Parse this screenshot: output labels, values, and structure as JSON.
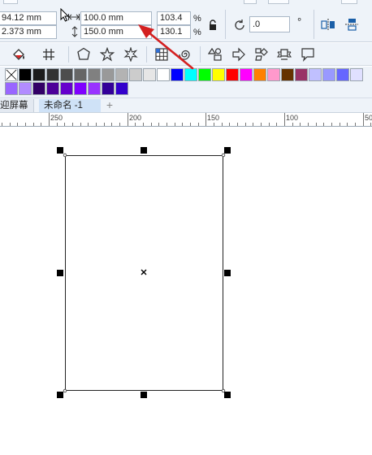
{
  "property_bar": {
    "x_value": "94.12 mm",
    "y_value": "2.373 mm",
    "width_value": "100.0 mm",
    "height_value": "150.0 mm",
    "scale_x": "103.4",
    "scale_y": "130.1",
    "percent_symbol": "%",
    "rotation_value": ".0",
    "degree_symbol": "°"
  },
  "palette": {
    "row1": [
      "#000000",
      "#1c1c1c",
      "#333333",
      "#4d4d4d",
      "#666666",
      "#808080",
      "#999999",
      "#b3b3b3",
      "#cccccc",
      "#e6e6e6",
      "#ffffff",
      "#0000ff",
      "#00ffff",
      "#00ff00",
      "#ffff00",
      "#ff0000",
      "#ff00ff",
      "#ff8000",
      "#ff99cc",
      "#663300",
      "#993366",
      "#c0c0ff",
      "#9999ff",
      "#6666ff",
      "#e0e0ff"
    ],
    "row2": [
      "#9966ff",
      "#b28cff",
      "#330066",
      "#4d0099",
      "#6600cc",
      "#8000ff",
      "#9933ff",
      "#330099",
      "#3300cc"
    ]
  },
  "tabs": {
    "welcome_tab": "迎屏幕",
    "document_tab": "未命名 -1",
    "add_tab": "+"
  },
  "ruler": {
    "labels": [
      "250",
      "200",
      "150",
      "100",
      "50"
    ]
  }
}
